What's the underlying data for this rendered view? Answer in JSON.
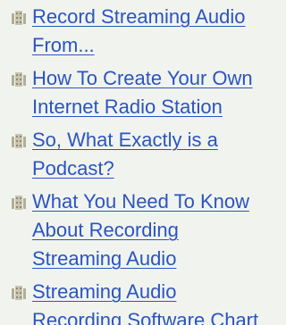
{
  "links": {
    "items": [
      {
        "label_lines": [
          "Record Streaming Audio",
          "From..."
        ],
        "icon": "film-reel-icon"
      },
      {
        "label_lines": [
          "How To Create Your Own",
          "Internet Radio Station"
        ],
        "icon": "film-reel-icon"
      },
      {
        "label_lines": [
          "So, What Exactly is a",
          "Podcast?"
        ],
        "icon": "film-reel-icon"
      },
      {
        "label_lines": [
          "What You Need To Know",
          "About Recording",
          "Streaming Audio"
        ],
        "icon": "film-reel-icon"
      },
      {
        "label_lines": [
          "Streaming Audio",
          "Recording Software Chart"
        ],
        "icon": "film-reel-icon"
      }
    ]
  },
  "colors": {
    "background": "#f1f4ee",
    "link": "#2b54c2",
    "bullet": "#b3ad97"
  }
}
